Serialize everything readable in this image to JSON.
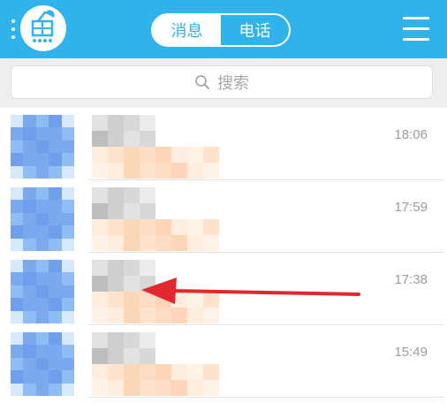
{
  "header": {
    "tabs": [
      {
        "label": "消息",
        "active": true
      },
      {
        "label": "电话",
        "active": false
      }
    ],
    "accent_color": "#2fb3ea"
  },
  "search": {
    "placeholder": "搜索",
    "icon": "search-icon"
  },
  "conversations": [
    {
      "time": "18:06",
      "avatar": "blurred",
      "name": "blurred",
      "preview": "blurred"
    },
    {
      "time": "17:59",
      "avatar": "blurred",
      "name": "blurred",
      "preview": "blurred"
    },
    {
      "time": "17:38",
      "avatar": "blurred",
      "name": "blurred",
      "preview": "blurred",
      "highlighted_by_arrow": true
    },
    {
      "time": "15:49",
      "avatar": "blurred",
      "name": "blurred",
      "preview": "blurred"
    }
  ],
  "annotation": {
    "arrow_color": "#e0282e",
    "points_to": "conversation 3 name"
  }
}
